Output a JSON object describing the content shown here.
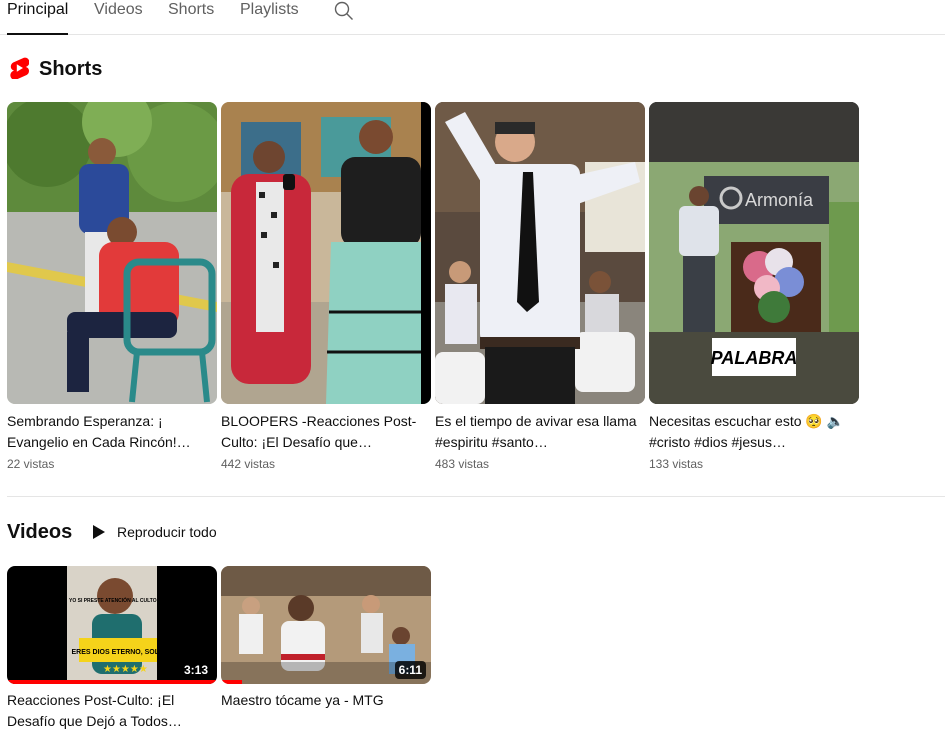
{
  "tabs": [
    "Principal",
    "Videos",
    "Shorts",
    "Playlists"
  ],
  "shorts_section": {
    "title": "Shorts"
  },
  "shorts": [
    {
      "title": "Sembrando Esperanza: ¡ Evangelio en Cada Rincón!…",
      "views": "22 vistas"
    },
    {
      "title": "BLOOPERS -Reacciones Post-Culto: ¡El Desafío que…",
      "views": "442 vistas"
    },
    {
      "title": "Es el tiempo de avivar esa llama #espiritu #santo…",
      "views": "483 vistas"
    },
    {
      "title": "Necesitas escuchar esto 🥺 🔈 #cristo #dios #jesus…",
      "views": "133 vistas",
      "thumb_text": "PALABRA",
      "banner_text": "Armonía"
    }
  ],
  "videos_section": {
    "title": "Videos",
    "play_all": "Reproducir todo"
  },
  "videos": [
    {
      "title": "Reacciones Post-Culto: ¡El Desafío que Dejó a Todos…",
      "duration": "3:13",
      "thumb_text_top": "YO SI PRESTE ATENCIÓN AL CULTO",
      "thumb_text_mid": "ERES DIOS ETERNO, SOLO",
      "progress_pct": 100
    },
    {
      "title": "Maestro tócame ya - MTG",
      "duration": "6:11",
      "progress_pct": 10
    }
  ],
  "colors": {
    "accent": "#ff0000",
    "text": "#0f0f0f",
    "secondary": "#606060"
  }
}
